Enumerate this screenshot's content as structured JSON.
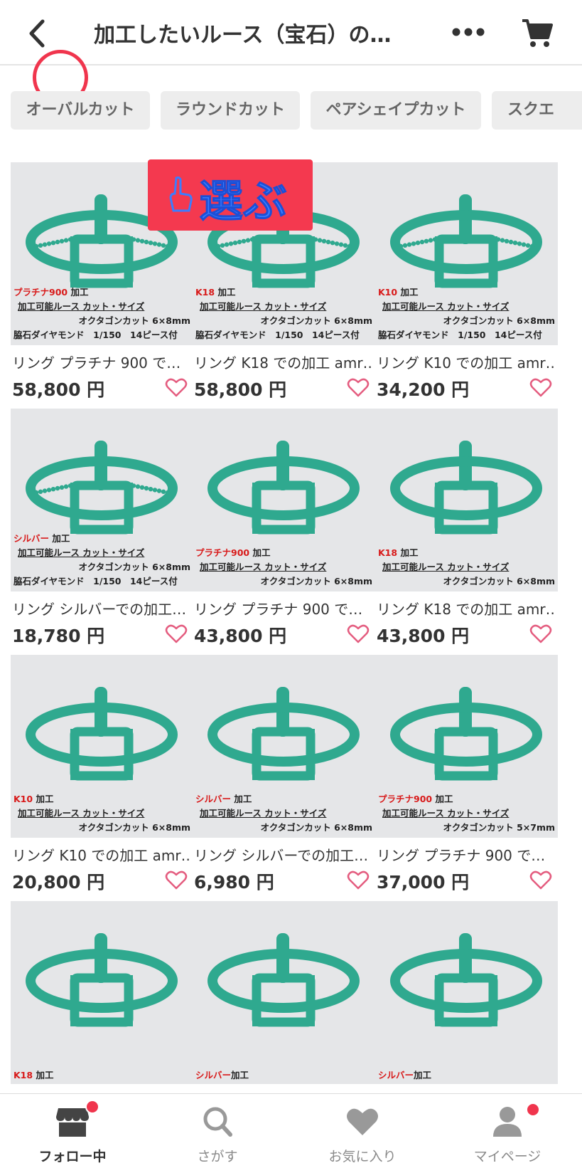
{
  "header": {
    "title": "加工したいルース（宝石）の…",
    "back_icon": "chevron-left-icon",
    "more_icon": "more-horizontal-icon",
    "cart_icon": "cart-icon"
  },
  "chips": [
    "オーバルカット",
    "ラウンドカット",
    "ペアシェイプカット",
    "スクエ"
  ],
  "sticker": {
    "text": "選ぶ",
    "icon": "pointing-hand-icon"
  },
  "colors": {
    "accent": "#f0354d",
    "ring": "#2fa98f",
    "heart": "#e45c7f",
    "metal_tag": "#d81a1a"
  },
  "products": [
    {
      "name": "リング プラチナ 900 で…",
      "price": "58,800 円",
      "tag": "プラチナ900",
      "tag_suffix": " 加工",
      "label1": "加工可能ルース カット・サイズ",
      "label2": "オクタゴンカット 6×8mm",
      "label3": "脇石ダイヤモンド　1/150　14ピース付"
    },
    {
      "name": "リング K18 での加工 amr…",
      "price": "58,800 円",
      "tag": "K18",
      "tag_suffix": " 加工",
      "label1": "加工可能ルース カット・サイズ",
      "label2": "オクタゴンカット 6×8mm",
      "label3": "脇石ダイヤモンド　1/150　14ピース付"
    },
    {
      "name": "リング K10 での加工 amr…",
      "price": "34,200 円",
      "tag": "K10",
      "tag_suffix": " 加工",
      "label1": "加工可能ルース カット・サイズ",
      "label2": "オクタゴンカット 6×8mm",
      "label3": "脇石ダイヤモンド　1/150　14ピース付"
    },
    {
      "name": "リング シルバーでの加工…",
      "price": "18,780 円",
      "tag": "シルバー",
      "tag_suffix": " 加工",
      "label1": "加工可能ルース カット・サイズ",
      "label2": "オクタゴンカット 6×8mm",
      "label3": "脇石ダイヤモンド　1/150　14ピース付"
    },
    {
      "name": "リング プラチナ 900 で…",
      "price": "43,800 円",
      "tag": "プラチナ900",
      "tag_suffix": " 加工",
      "label1": "加工可能ルース カット・サイズ",
      "label2": "オクタゴンカット 6×8mm",
      "label3": ""
    },
    {
      "name": "リング K18 での加工 amr…",
      "price": "43,800 円",
      "tag": "K18",
      "tag_suffix": " 加工",
      "label1": "加工可能ルース カット・サイズ",
      "label2": "オクタゴンカット 6×8mm",
      "label3": ""
    },
    {
      "name": "リング K10 での加工 amr…",
      "price": "20,800 円",
      "tag": "K10",
      "tag_suffix": " 加工",
      "label1": "加工可能ルース カット・サイズ",
      "label2": "オクタゴンカット 6×8mm",
      "label3": ""
    },
    {
      "name": "リング シルバーでの加工…",
      "price": "6,980 円",
      "tag": "シルバー",
      "tag_suffix": " 加工",
      "label1": "加工可能ルース カット・サイズ",
      "label2": "オクタゴンカット 6×8mm",
      "label3": ""
    },
    {
      "name": "リング プラチナ 900 で…",
      "price": "37,000 円",
      "tag": "プラチナ900",
      "tag_suffix": " 加工",
      "label1": "加工可能ルース カット・サイズ",
      "label2": "オクタゴンカット 5×7mm",
      "label3": ""
    },
    {
      "name": "",
      "price": "",
      "tag": "K18",
      "tag_suffix": " 加工",
      "label1": "",
      "label2": "",
      "label3": ""
    },
    {
      "name": "",
      "price": "",
      "tag": "シルバー",
      "tag_suffix": "加工",
      "label1": "",
      "label2": "",
      "label3": ""
    },
    {
      "name": "",
      "price": "",
      "tag": "シルバー",
      "tag_suffix": "加工",
      "label1": "",
      "label2": "",
      "label3": ""
    }
  ],
  "tabs": [
    {
      "label": "フォロー中",
      "icon": "store-icon",
      "badge": true,
      "active": true
    },
    {
      "label": "さがす",
      "icon": "search-icon",
      "badge": false,
      "active": false
    },
    {
      "label": "お気に入り",
      "icon": "heart-icon",
      "badge": false,
      "active": false
    },
    {
      "label": "マイページ",
      "icon": "person-icon",
      "badge": true,
      "active": false
    }
  ]
}
